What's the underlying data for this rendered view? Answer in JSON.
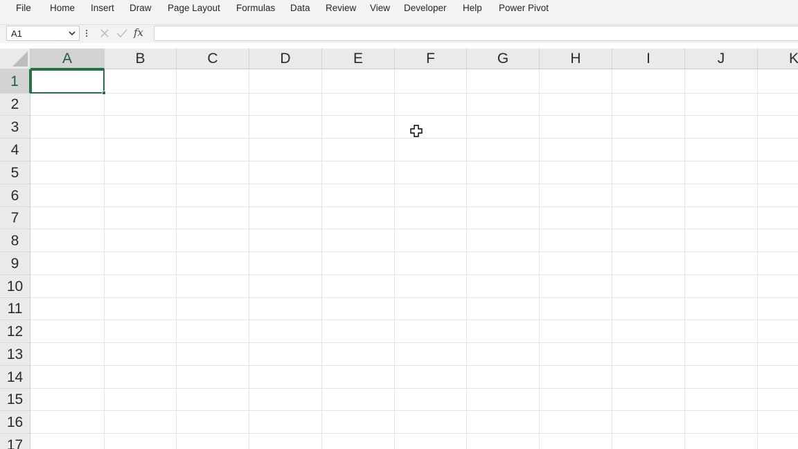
{
  "menu": {
    "items": [
      {
        "label": "File"
      },
      {
        "label": "Home"
      },
      {
        "label": "Insert"
      },
      {
        "label": "Draw"
      },
      {
        "label": "Page Layout"
      },
      {
        "label": "Formulas"
      },
      {
        "label": "Data"
      },
      {
        "label": "Review"
      },
      {
        "label": "View"
      },
      {
        "label": "Developer"
      },
      {
        "label": "Help"
      },
      {
        "label": "Power Pivot"
      }
    ]
  },
  "formula_bar": {
    "name_box": "A1",
    "fx_label": "fx",
    "formula_value": ""
  },
  "grid": {
    "columns": [
      "A",
      "B",
      "C",
      "D",
      "E",
      "F",
      "G",
      "H",
      "I",
      "J",
      "K"
    ],
    "rows": [
      "1",
      "2",
      "3",
      "4",
      "5",
      "6",
      "7",
      "8",
      "9",
      "10",
      "11",
      "12",
      "13",
      "14",
      "15",
      "16",
      "17"
    ],
    "selected_column": "A",
    "selected_row": "1"
  },
  "colors": {
    "accent": "#217346",
    "header_bg": "#eaeaea",
    "gridline": "#e3e3e3"
  },
  "icons": {
    "name_box_dropdown": "chevron-down-icon",
    "more": "vertical-dots-icon",
    "cancel": "close-icon",
    "enter": "check-icon",
    "cursor": "cell-select-cross-icon"
  }
}
